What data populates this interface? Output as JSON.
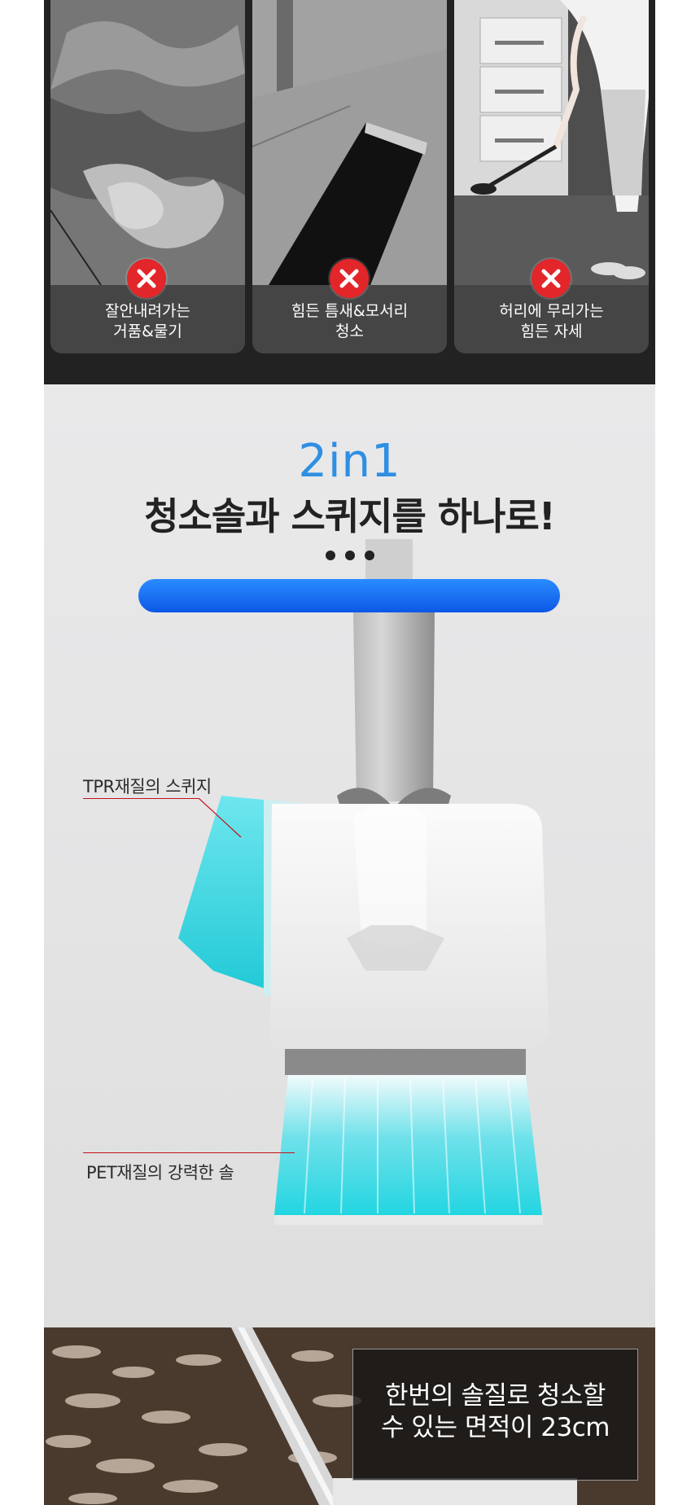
{
  "problems": [
    {
      "caption": "잘안내려가는\n거품&물기",
      "icon": "red-x-icon"
    },
    {
      "caption": "힘든 틈새&모서리\n청소",
      "icon": "red-x-icon"
    },
    {
      "caption": "허리에 무리가는\n힘든 자세",
      "icon": "red-x-icon"
    }
  ],
  "product": {
    "accent_title": "2in1",
    "main_title": "청소솔과 스퀴지를 하나로!",
    "label_squeegee": "TPR재질의 스퀴지",
    "label_brush": "PET재질의 강력한 솔"
  },
  "bottom": {
    "info_text": "한번의 솔질로 청소할\n수 있는 면적이 23cm"
  },
  "colors": {
    "accent_blue": "#2e8fe3",
    "bar_blue": "#1a6ff0",
    "x_red": "#e2262a",
    "teal": "#29d3de",
    "pointer_red": "#c4121b"
  }
}
